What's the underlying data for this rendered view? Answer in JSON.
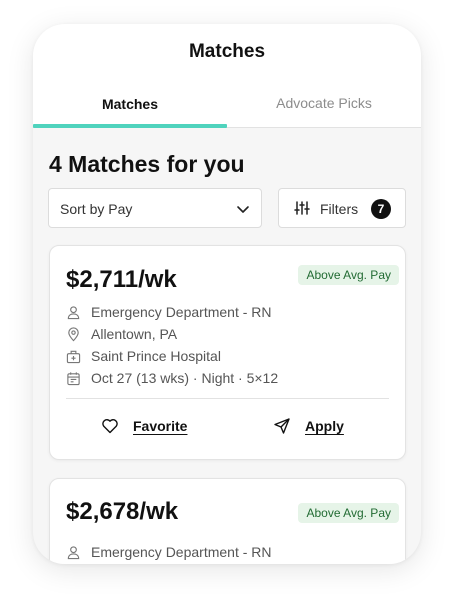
{
  "header": {
    "title": "Matches",
    "tabs": [
      {
        "label": "Matches",
        "active": true
      },
      {
        "label": "Advocate Picks",
        "active": false
      }
    ]
  },
  "results": {
    "heading": "4 Matches for you",
    "sort_label": "Sort by Pay",
    "filters_label": "Filters",
    "filters_count": "7"
  },
  "cards": [
    {
      "pay": "$2,711/wk",
      "badge": "Above Avg. Pay",
      "specialty": "Emergency Department - RN",
      "location": "Allentown, PA",
      "facility": "Saint Prince Hospital",
      "schedule": "Oct 27 (13 wks) · Night · 5×12",
      "favorite_label": "Favorite",
      "apply_label": "Apply"
    },
    {
      "pay": "$2,678/wk",
      "badge": "Above Avg. Pay",
      "specialty": "Emergency Department - RN"
    }
  ],
  "colors": {
    "accent": "#4fd3bd",
    "badge_bg": "#e6f4e8",
    "badge_text": "#226b33"
  }
}
